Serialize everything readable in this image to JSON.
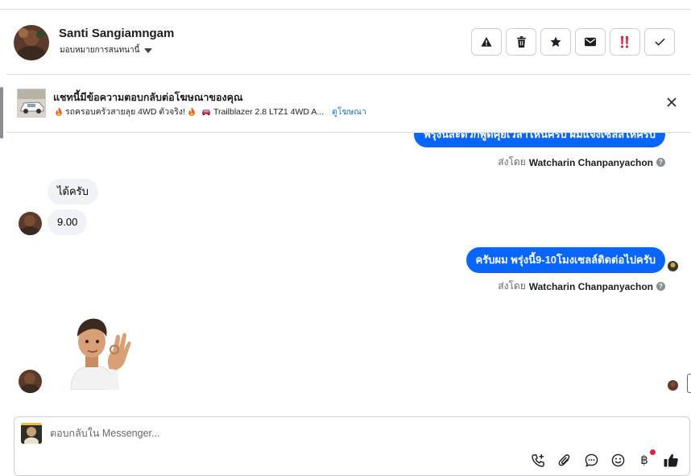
{
  "header": {
    "contact_name": "Santi Sangiamngam",
    "assign_label": "มอบหมายการสนทนานี้"
  },
  "ad": {
    "title": "แชทนี้มีข้อความตอบกลับต่อโฆษณาของคุณ",
    "text_1": "รถครอบครัวสายลุย 4WD ตัวจริง!",
    "text_2": "Trailblazer 2.8 LTZ1 4WD A...",
    "link": "ดูโฆษณา"
  },
  "messages": {
    "out_partial": "พรุ่งนี้สะดวกพูดคุยเวลาไหนครับ ผมแจ้งเซลล์ให้ครับ",
    "sent_by_prefix": "ส่งโดย",
    "sent_by_name": "Watcharin Chanpanyachon",
    "in_1": "ได้ครับ",
    "in_2": "9.00",
    "out_2": "ครับผม พรุ่งนี้9-10โมงเซลล์ติดต่อไปครับ"
  },
  "composer": {
    "placeholder": "ตอบกลับใน Messenger..."
  },
  "icons": {
    "header_actions": [
      "warning-icon",
      "trash-icon",
      "star-icon",
      "mail-icon",
      "spam-icon",
      "check-icon"
    ],
    "composer_tools": [
      "call-add-icon",
      "attach-icon",
      "chat-bubble-icon",
      "emoji-icon",
      "baht-icon",
      "thumbs-up-icon"
    ]
  },
  "colors": {
    "outgoing_bubble": "#0866ff",
    "incoming_bubble": "#f0f2f5",
    "link": "#1b74e4",
    "spam_red": "#e41e3f"
  }
}
